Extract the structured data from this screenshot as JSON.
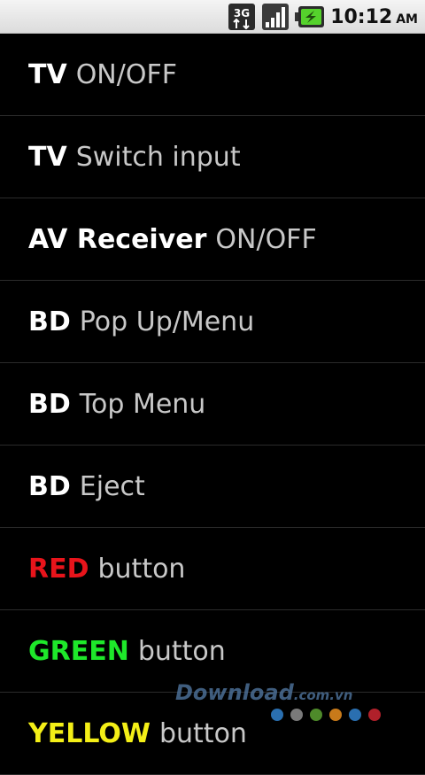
{
  "status_bar": {
    "network_label": "3G",
    "time": "10:12",
    "ampm": "AM",
    "icons": [
      "network-3g-icon",
      "signal-strength-icon",
      "battery-charging-icon"
    ]
  },
  "commands": [
    {
      "device": "TV",
      "command": "ON/OFF",
      "color": "#ffffff"
    },
    {
      "device": "TV",
      "command": "Switch input",
      "color": "#ffffff"
    },
    {
      "device": "AV Receiver",
      "command": "ON/OFF",
      "color": "#ffffff"
    },
    {
      "device": "BD",
      "command": "Pop Up/Menu",
      "color": "#ffffff"
    },
    {
      "device": "BD",
      "command": "Top Menu",
      "color": "#ffffff"
    },
    {
      "device": "BD",
      "command": "Eject",
      "color": "#ffffff"
    },
    {
      "device": "RED",
      "command": "button",
      "color": "#e8141b"
    },
    {
      "device": "GREEN",
      "command": "button",
      "color": "#1ee82a"
    },
    {
      "device": "YELLOW",
      "command": "button",
      "color": "#f4ef17"
    }
  ],
  "watermark": {
    "text": "Download",
    "suffix": ".com.vn",
    "dot_colors": [
      "#2a6fb0",
      "#7a7a7a",
      "#4e8a2a",
      "#c87a1a",
      "#2a6fb0",
      "#b0202a"
    ]
  }
}
